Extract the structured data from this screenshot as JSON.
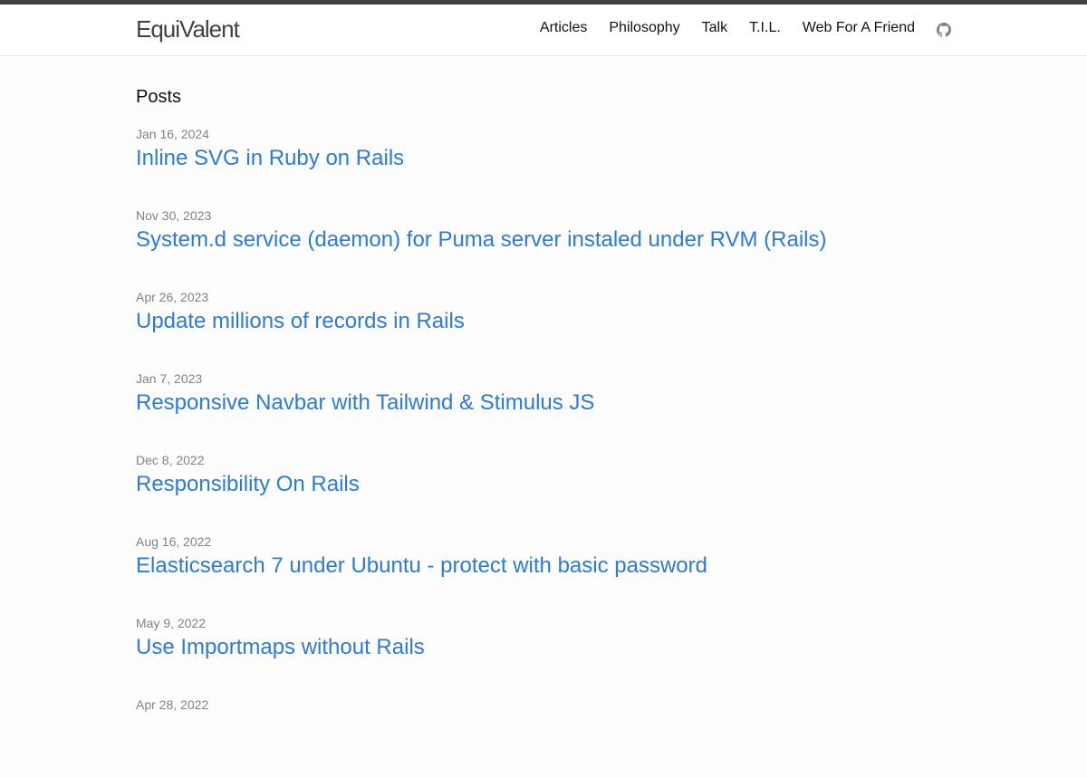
{
  "site": {
    "title": "EquiValent"
  },
  "nav": {
    "items": [
      {
        "label": "Articles"
      },
      {
        "label": "Philosophy"
      },
      {
        "label": "Talk"
      },
      {
        "label": "T.I.L."
      },
      {
        "label": "Web For A Friend"
      }
    ],
    "github_icon": "github-icon"
  },
  "main": {
    "heading": "Posts",
    "posts": [
      {
        "date": "Jan 16, 2024",
        "title": "Inline SVG in Ruby on Rails"
      },
      {
        "date": "Nov 30, 2023",
        "title": "System.d service (daemon) for Puma server instaled under RVM (Rails)"
      },
      {
        "date": "Apr 26, 2023",
        "title": "Update millions of records in Rails"
      },
      {
        "date": "Jan 7, 2023",
        "title": "Responsive Navbar with Tailwind & Stimulus JS"
      },
      {
        "date": "Dec 8, 2022",
        "title": "Responsibility On Rails"
      },
      {
        "date": "Aug 16, 2022",
        "title": "Elasticsearch 7 under Ubuntu - protect with basic password"
      },
      {
        "date": "May 9, 2022",
        "title": "Use Importmaps without Rails"
      },
      {
        "date": "Apr 28, 2022",
        "title": ""
      }
    ]
  },
  "colors": {
    "link": "#2a7ae2",
    "meta": "#828282",
    "top_rule": "#424242"
  }
}
